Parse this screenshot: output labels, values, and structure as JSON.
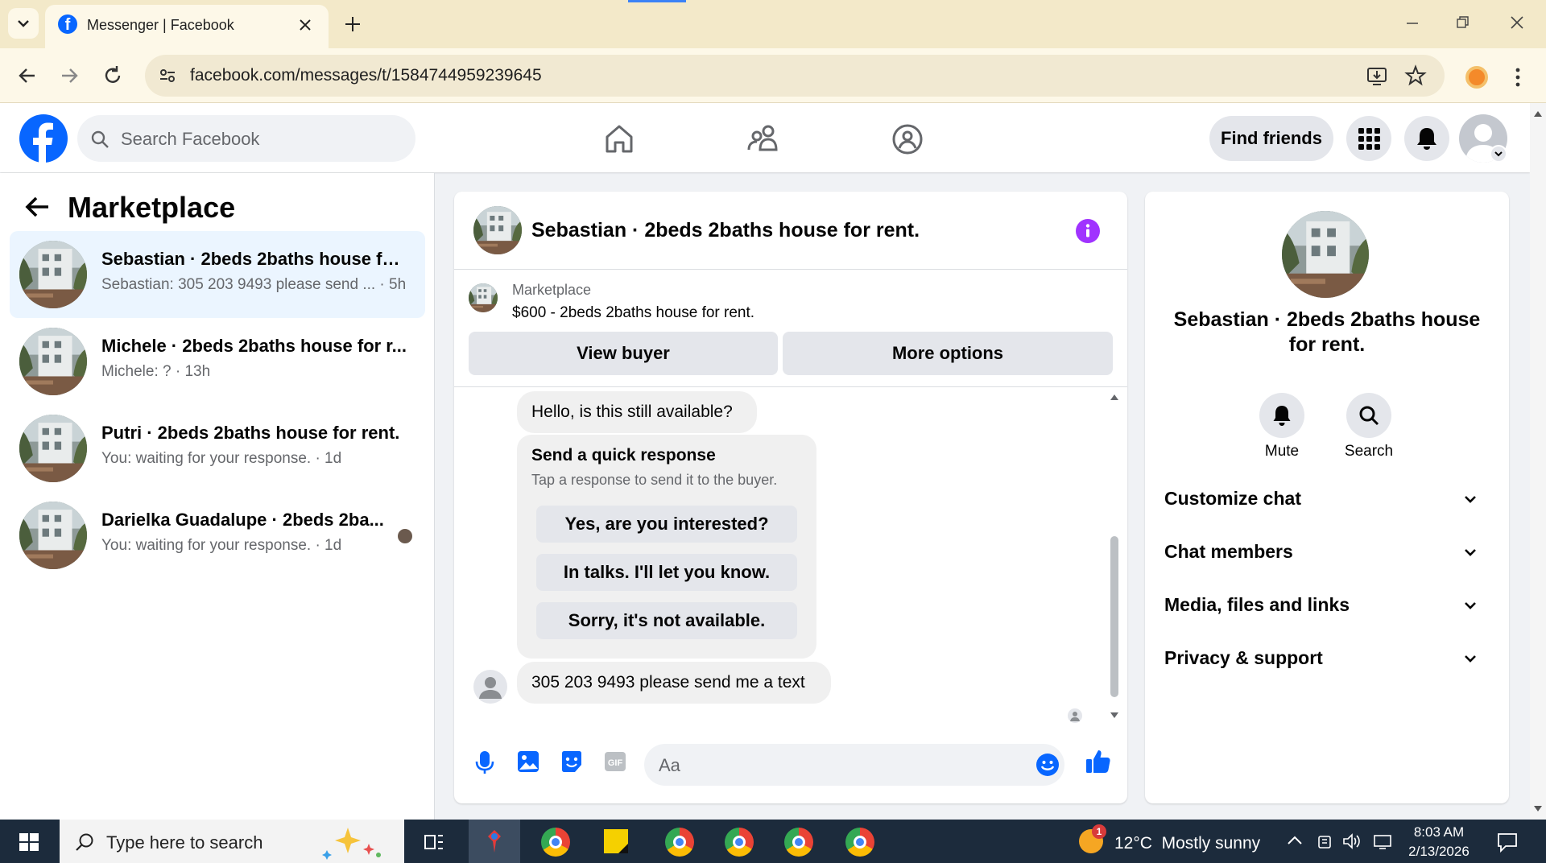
{
  "browser": {
    "tab_title": "Messenger | Facebook",
    "url": "facebook.com/messages/t/1584744959239645"
  },
  "fb": {
    "search_placeholder": "Search Facebook",
    "find_friends": "Find friends"
  },
  "left": {
    "title": "Marketplace",
    "conversations": [
      {
        "name": "Sebastian · 2beds 2baths house fo...",
        "preview": "Sebastian: 305 203 9493 please send ... · 5h",
        "selected": true
      },
      {
        "name": "Michele · 2beds 2baths house for r...",
        "preview": "Michele: ? · 13h",
        "selected": false
      },
      {
        "name": "Putri · 2beds 2baths house for rent.",
        "preview": "You: waiting for your response. · 1d",
        "selected": false
      },
      {
        "name": "Darielka Guadalupe · 2beds 2ba...",
        "preview": "You: waiting for your response. · 1d",
        "selected": false
      }
    ]
  },
  "chat": {
    "header_title": "Sebastian · 2beds 2baths house for rent.",
    "listing_label": "Marketplace",
    "listing_title": "$600 - 2beds 2baths house for rent.",
    "view_buyer": "View buyer",
    "more_options": "More options",
    "msg1": "Hello, is this still available?",
    "quick_title": "Send a quick response",
    "quick_sub": "Tap a response to send it to the buyer.",
    "quick_options": [
      "Yes, are you interested?",
      "In talks. I'll let you know.",
      "Sorry, it's not available."
    ],
    "msg2": "305 203 9493 please send me a text",
    "composer_placeholder": "Aa"
  },
  "right": {
    "title": "Sebastian · 2beds 2baths house for rent.",
    "mute": "Mute",
    "search": "Search",
    "sections": [
      "Customize chat",
      "Chat members",
      "Media, files and links",
      "Privacy & support"
    ]
  },
  "taskbar": {
    "search_placeholder": "Type here to search",
    "weather": "12°C  Mostly sunny",
    "time": "8:03 AM",
    "date": "2/13/2026",
    "weather_badge": "1"
  },
  "colors": {
    "fb_blue": "#0866ff",
    "selected_bg": "#ebf5ff",
    "info_purple": "#a033ff",
    "tabstrip": "#f3e9c9",
    "taskbar": "#1c2b3c"
  }
}
